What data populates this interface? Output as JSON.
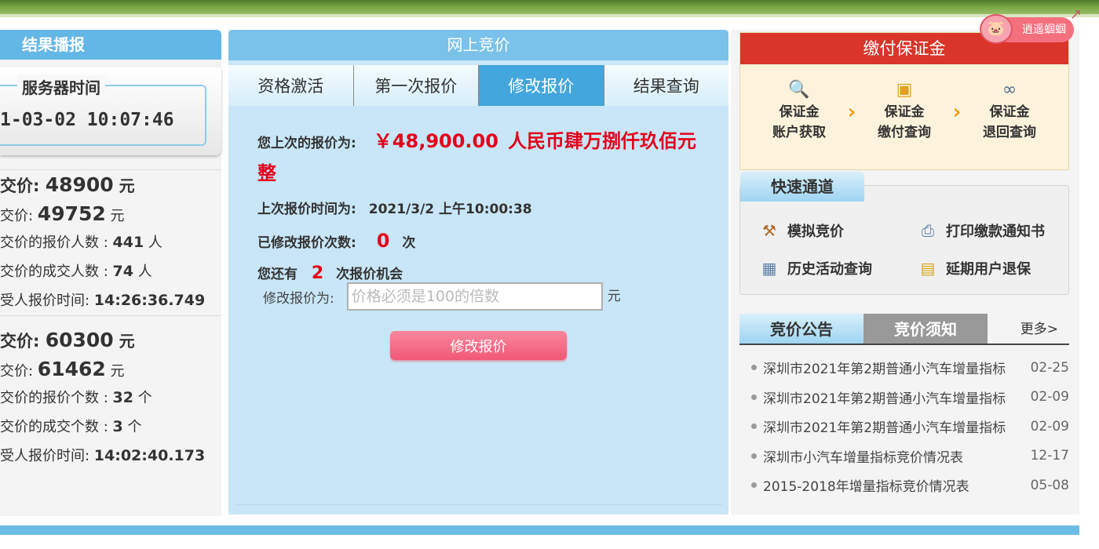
{
  "left": {
    "title": "结果播报",
    "server_time_label": "服务器时间",
    "server_time": "1-03-02 10:07:46",
    "blocks": [
      {
        "rows": [
          {
            "label": "交价: ",
            "value": "48900",
            "unit": " 元"
          },
          {
            "label": "交价:  ",
            "value": "49752",
            "unit": " 元"
          },
          {
            "label": "交价的报价人数 : ",
            "value": "441",
            "unit": " 人"
          },
          {
            "label": "交价的成交人数 : ",
            "value": "74",
            "unit": " 人"
          },
          {
            "label": "受人报价时间:  ",
            "value": "14:26:36.749",
            "unit": ""
          }
        ]
      },
      {
        "rows": [
          {
            "label": "交价: ",
            "value": "60300",
            "unit": " 元"
          },
          {
            "label": "交价:  ",
            "value": "61462",
            "unit": " 元"
          },
          {
            "label": "交价的报价个数 : ",
            "value": "32",
            "unit": " 个"
          },
          {
            "label": "交价的成交个数 : ",
            "value": "3",
            "unit": " 个"
          },
          {
            "label": "受人报价时间:  ",
            "value": "14:02:40.173",
            "unit": ""
          }
        ]
      }
    ]
  },
  "middle": {
    "title": "网上竞价",
    "tabs": [
      {
        "label": "资格激活",
        "active": false
      },
      {
        "label": "第一次报价",
        "active": false
      },
      {
        "label": "修改报价",
        "active": true
      },
      {
        "label": "结果查询",
        "active": false
      }
    ],
    "last_bid_label": "您上次的报价为:",
    "last_bid_amount": "￥48,900.00",
    "last_bid_chinese": "人民币肆万捌仟玖佰元",
    "last_bid_chinese_wrap": "整",
    "last_time_label": "上次报价时间为:",
    "last_time_value": "2021/3/2 上午10:00:38",
    "modify_count_label": "已修改报价次数:",
    "modify_count_value": "0",
    "modify_count_unit": "次",
    "remaining_prefix": "您还有",
    "remaining_value": "2",
    "remaining_suffix": "次报价机会",
    "input_label": "修改报价为:",
    "input_placeholder": "价格必须是100的倍数",
    "input_unit": "元",
    "button_label": "修改报价"
  },
  "right": {
    "deposit": {
      "title": "缴付保证金",
      "steps": [
        {
          "line1": "保证金",
          "line2": "账户获取",
          "icon": "document-search-icon"
        },
        {
          "line1": "保证金",
          "line2": "缴付查询",
          "icon": "wallet-icon"
        },
        {
          "line1": "保证金",
          "line2": "退回查询",
          "icon": "binoculars-icon"
        }
      ]
    },
    "mascot_text": "逍遥蝈蝈",
    "quick": {
      "title": "快速通道",
      "items": [
        {
          "label": "模拟竞价",
          "icon": "gavel-icon"
        },
        {
          "label": "打印缴款通知书",
          "icon": "printer-icon"
        },
        {
          "label": "历史活动查询",
          "icon": "calendar-icon"
        },
        {
          "label": "延期用户退保",
          "icon": "clipboard-icon"
        }
      ]
    },
    "news": {
      "tab_announce": "竞价公告",
      "tab_notice": "竞价须知",
      "more": "更多>",
      "items": [
        {
          "title": "深圳市2021年第2期普通小汽车增量指标",
          "date": "02-25"
        },
        {
          "title": "深圳市2021年第2期普通小汽车增量指标",
          "date": "02-09"
        },
        {
          "title": "深圳市2021年第2期普通小汽车增量指标",
          "date": "02-09"
        },
        {
          "title": "深圳市小汽车增量指标竞价情况表",
          "date": "12-17"
        },
        {
          "title": "2015-2018年增量指标竞价情况表",
          "date": "05-08"
        }
      ]
    }
  },
  "colors": {
    "accent_blue": "#43a6dd",
    "header_red": "#d9352a",
    "price_red": "#e3001b",
    "button_pink": "#f15877"
  }
}
